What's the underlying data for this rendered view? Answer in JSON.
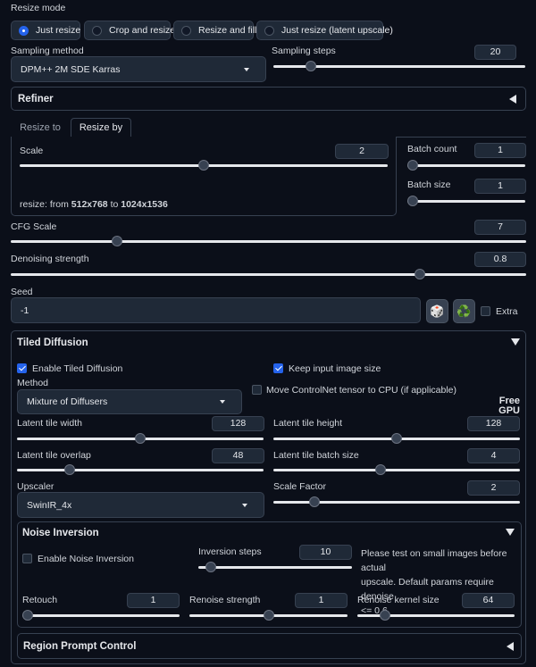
{
  "resize_mode": {
    "label": "Resize mode",
    "options": [
      {
        "label": "Just resize",
        "selected": true
      },
      {
        "label": "Crop and resize",
        "selected": false
      },
      {
        "label": "Resize and fill",
        "selected": false
      },
      {
        "label": "Just resize (latent upscale)",
        "selected": false
      }
    ]
  },
  "sampling": {
    "method_label": "Sampling method",
    "method_value": "DPM++ 2M SDE Karras",
    "steps_label": "Sampling steps",
    "steps_value": "20",
    "steps_fraction": 0.133
  },
  "refiner": {
    "title": "Refiner"
  },
  "resize_tabs": {
    "tabs": [
      "Resize to",
      "Resize by"
    ],
    "active": "Resize by"
  },
  "scale": {
    "label": "Scale",
    "value": "2",
    "fraction": 0.5
  },
  "resize_info": {
    "prefix": "resize: from ",
    "from": "512x768",
    "middle": " to ",
    "to": "1024x1536"
  },
  "batch_count": {
    "label": "Batch count",
    "value": "1",
    "fraction": 0
  },
  "batch_size": {
    "label": "Batch size",
    "value": "1",
    "fraction": 0
  },
  "cfg": {
    "label": "CFG Scale",
    "value": "7",
    "fraction": 0.2
  },
  "denoise": {
    "label": "Denoising strength",
    "value": "0.8",
    "fraction": 0.8
  },
  "seed": {
    "label": "Seed",
    "value": "-1",
    "dice_icon": "🎲",
    "recycle_icon": "♻️",
    "extra_label": "Extra"
  },
  "tiled_diffusion": {
    "title": "Tiled Diffusion",
    "enable_label": "Enable Tiled Diffusion",
    "keep_size_label": "Keep input image size",
    "method_label": "Method",
    "method_value": "Mixture of Diffusers",
    "move_cn_label": "Move ControlNet tensor to CPU (if applicable)",
    "free_gpu_line1": "Free",
    "free_gpu_line2": "GPU",
    "tile_width": {
      "label": "Latent tile width",
      "value": "128",
      "fraction": 0.5
    },
    "tile_height": {
      "label": "Latent tile height",
      "value": "128",
      "fraction": 0.5
    },
    "tile_overlap": {
      "label": "Latent tile overlap",
      "value": "48",
      "fraction": 0.2
    },
    "tile_batch": {
      "label": "Latent tile batch size",
      "value": "4",
      "fraction": 0.43
    },
    "upscaler_label": "Upscaler",
    "upscaler_value": "SwinIR_4x",
    "scale_factor": {
      "label": "Scale Factor",
      "value": "2",
      "fraction": 0.15
    }
  },
  "noise_inversion": {
    "title": "Noise Inversion",
    "enable_label": "Enable Noise Inversion",
    "steps": {
      "label": "Inversion steps",
      "value": "10",
      "fraction": 0.05
    },
    "note_line1": "Please test on small images before actual",
    "note_line2": "upscale. Default params require denoise",
    "note_line3": "<= 0.6",
    "retouch": {
      "label": "Retouch",
      "value": "1",
      "fraction": 0
    },
    "renoise_strength": {
      "label": "Renoise strength",
      "value": "1",
      "fraction": 0.5
    },
    "renoise_kernel": {
      "label": "Renoise kernel size",
      "value": "64",
      "fraction": 0.15
    }
  },
  "region_prompt": {
    "title": "Region Prompt Control"
  },
  "colors": {
    "accent": "#2563eb",
    "background": "#0b0f19",
    "panel": "#1f2937",
    "border": "#374151"
  }
}
